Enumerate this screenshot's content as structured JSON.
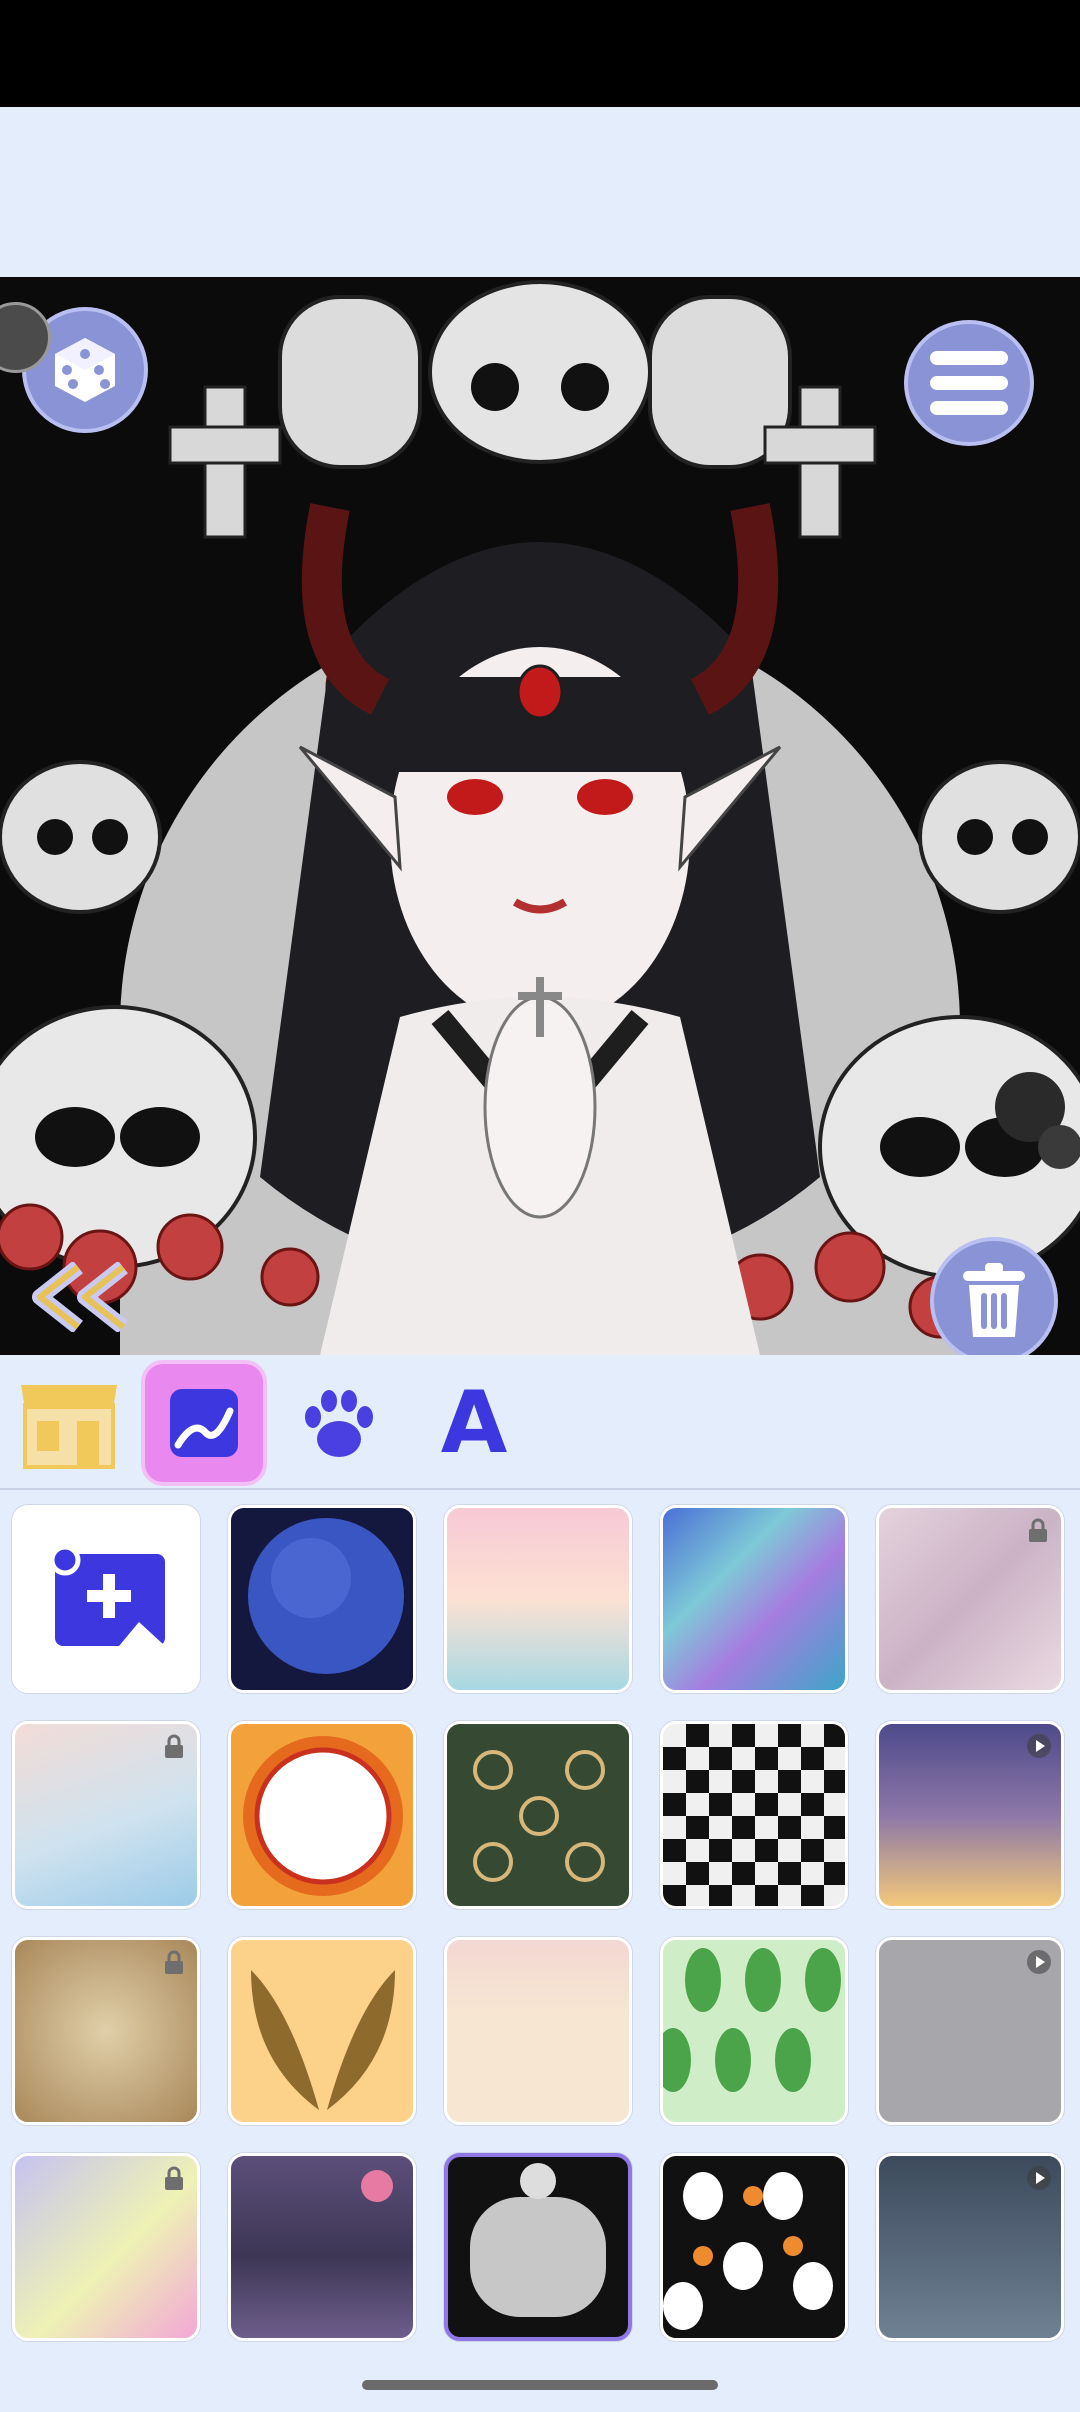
{
  "colors": {
    "accent": "#8a93d6",
    "accent_light": "#b9bff0",
    "toolbar_bg": "#e4edfb",
    "active_tab": "#e988ef",
    "selected_border": "#8f78e6",
    "add_tile": "#3d37e0"
  },
  "canvas_controls": {
    "random_icon": "dice-icon",
    "menu_icon": "list-icon",
    "back_icon": "double-chevron-left-icon",
    "delete_icon": "trash-icon"
  },
  "tabs": [
    {
      "icon": "shop-icon",
      "active": false
    },
    {
      "icon": "background-image-icon",
      "active": true
    },
    {
      "icon": "paw-icon",
      "active": false
    },
    {
      "icon": "text-a-icon",
      "active": false
    }
  ],
  "tab_text_glyph": "A",
  "backgrounds": [
    {
      "name": "add-custom",
      "locked": false,
      "video": false,
      "selected": false
    },
    {
      "name": "galaxy-planet",
      "locked": false,
      "video": false,
      "selected": false
    },
    {
      "name": "pastel-clouds",
      "locked": false,
      "video": false,
      "selected": false
    },
    {
      "name": "blue-swirl",
      "locked": false,
      "video": false,
      "selected": false
    },
    {
      "name": "pink-marble",
      "locked": true,
      "video": false,
      "selected": false
    },
    {
      "name": "watercolor-pastel",
      "locked": true,
      "video": false,
      "selected": false
    },
    {
      "name": "orange-sun-frame",
      "locked": false,
      "video": false,
      "selected": false
    },
    {
      "name": "green-pattern",
      "locked": false,
      "video": false,
      "selected": false
    },
    {
      "name": "checkerboard",
      "locked": false,
      "video": false,
      "selected": false
    },
    {
      "name": "sunset-sky",
      "locked": false,
      "video": true,
      "selected": false
    },
    {
      "name": "old-paper",
      "locked": true,
      "video": false,
      "selected": false
    },
    {
      "name": "golden-wings",
      "locked": false,
      "video": false,
      "selected": false
    },
    {
      "name": "floral-cream",
      "locked": false,
      "video": false,
      "selected": false
    },
    {
      "name": "green-leaves",
      "locked": false,
      "video": false,
      "selected": false
    },
    {
      "name": "grey-skulls",
      "locked": false,
      "video": true,
      "selected": false
    },
    {
      "name": "paint-splash",
      "locked": true,
      "video": false,
      "selected": false
    },
    {
      "name": "purple-lake",
      "locked": false,
      "video": false,
      "selected": false
    },
    {
      "name": "halloween-skull-frame",
      "locked": false,
      "video": false,
      "selected": true
    },
    {
      "name": "ghosts-pattern",
      "locked": false,
      "video": false,
      "selected": false
    },
    {
      "name": "night-moon-sky",
      "locked": false,
      "video": true,
      "selected": false
    }
  ]
}
